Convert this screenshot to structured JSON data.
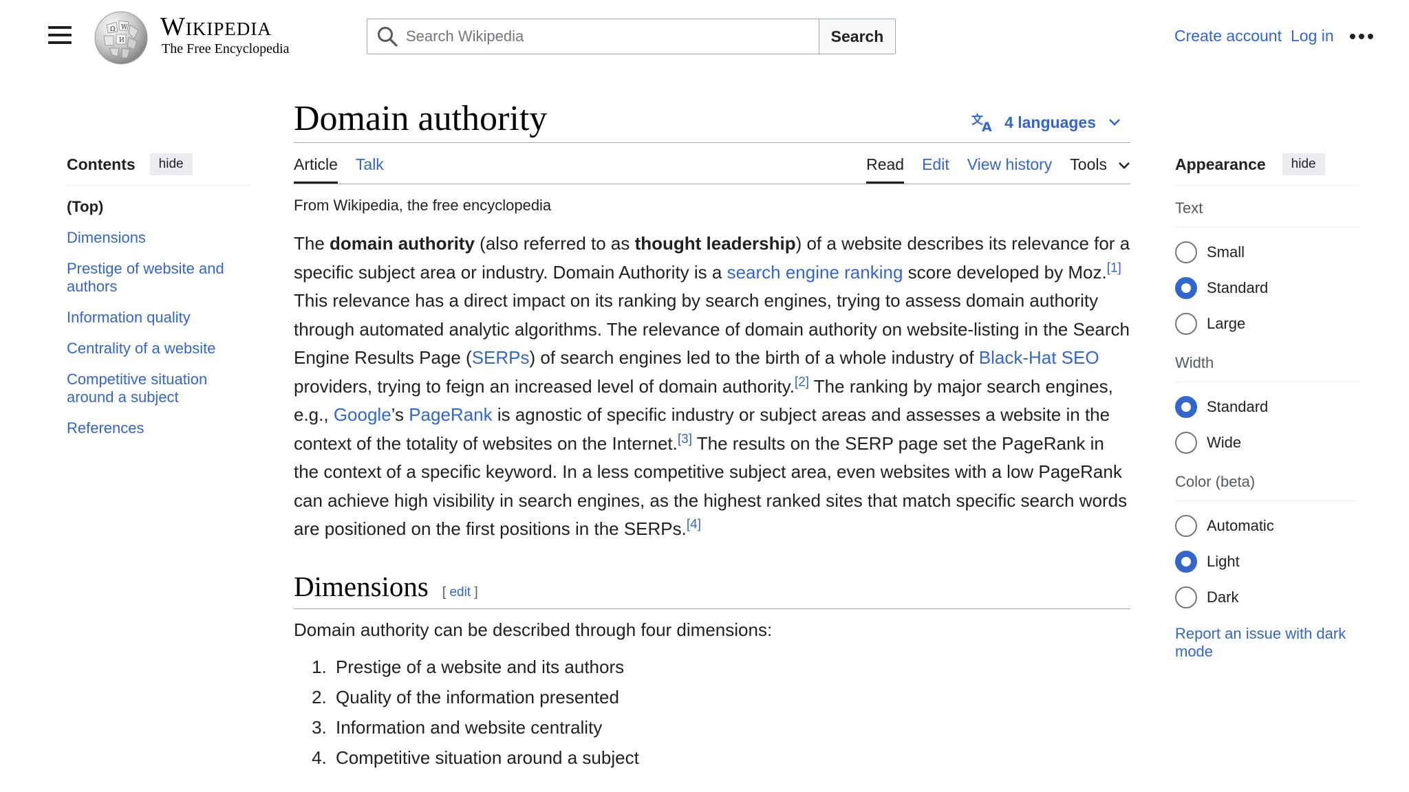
{
  "header": {
    "logo_title": "Wikipedia",
    "logo_tagline": "The Free Encyclopedia",
    "search_placeholder": "Search Wikipedia",
    "search_button": "Search",
    "create_account": "Create account",
    "log_in": "Log in"
  },
  "toc": {
    "title": "Contents",
    "hide": "hide",
    "items": [
      "(Top)",
      "Dimensions",
      "Prestige of website and authors",
      "Information quality",
      "Centrality of a website",
      "Competitive situation around a subject",
      "References"
    ]
  },
  "article": {
    "title": "Domain authority",
    "languages": "4 languages",
    "tabs_left": [
      "Article",
      "Talk"
    ],
    "tabs_right": [
      "Read",
      "Edit",
      "View history",
      "Tools"
    ],
    "tagline": "From Wikipedia, the free encyclopedia",
    "intro": {
      "t1": "The ",
      "b1": "domain authority",
      "t2": " (also referred to as ",
      "b2": "thought leadership",
      "t3": ") of a website describes its relevance for a specific subject area or industry. Domain Authority is a ",
      "l1": "search engine ranking",
      "t4": " score developed by Moz.",
      "r1": "[1]",
      "t5": " This relevance has a direct impact on its ranking by search engines, trying to assess domain authority through automated analytic algorithms. The relevance of domain authority on website-listing in the Search Engine Results Page (",
      "l2": "SERPs",
      "t6": ") of search engines led to the birth of a whole industry of ",
      "l3": "Black-Hat SEO",
      "t7": " providers, trying to feign an increased level of domain authority.",
      "r2": "[2]",
      "t8": " The ranking by major search engines, e.g., ",
      "l4": "Google",
      "t9": "’s ",
      "l5": "PageRank",
      "t10": " is agnostic of specific industry or subject areas and assesses a website in the context of the totality of websites on the Internet.",
      "r3": "[3]",
      "t11": " The results on the SERP page set the PageRank in the context of a specific keyword. In a less competitive subject area, even websites with a low PageRank can achieve high visibility in search engines, as the highest ranked sites that match specific search words are positioned on the first positions in the SERPs.",
      "r4": "[4]"
    },
    "section_title": "Dimensions",
    "section_edit": "edit",
    "section_edit_open": "[",
    "section_edit_close": "]",
    "section_intro": "Domain authority can be described through four dimensions:",
    "dimensions": [
      "Prestige of a website and its authors",
      "Quality of the information presented",
      "Information and website centrality",
      "Competitive situation around a subject"
    ]
  },
  "appearance": {
    "title": "Appearance",
    "hide": "hide",
    "text_label": "Text",
    "text_options": [
      "Small",
      "Standard",
      "Large"
    ],
    "width_label": "Width",
    "width_options": [
      "Standard",
      "Wide"
    ],
    "color_label": "Color (beta)",
    "color_options": [
      "Automatic",
      "Light",
      "Dark"
    ],
    "report": "Report an issue with dark mode"
  },
  "colors": {
    "link": "#3366cc",
    "text": "#202122",
    "border": "#a2a9b1"
  }
}
